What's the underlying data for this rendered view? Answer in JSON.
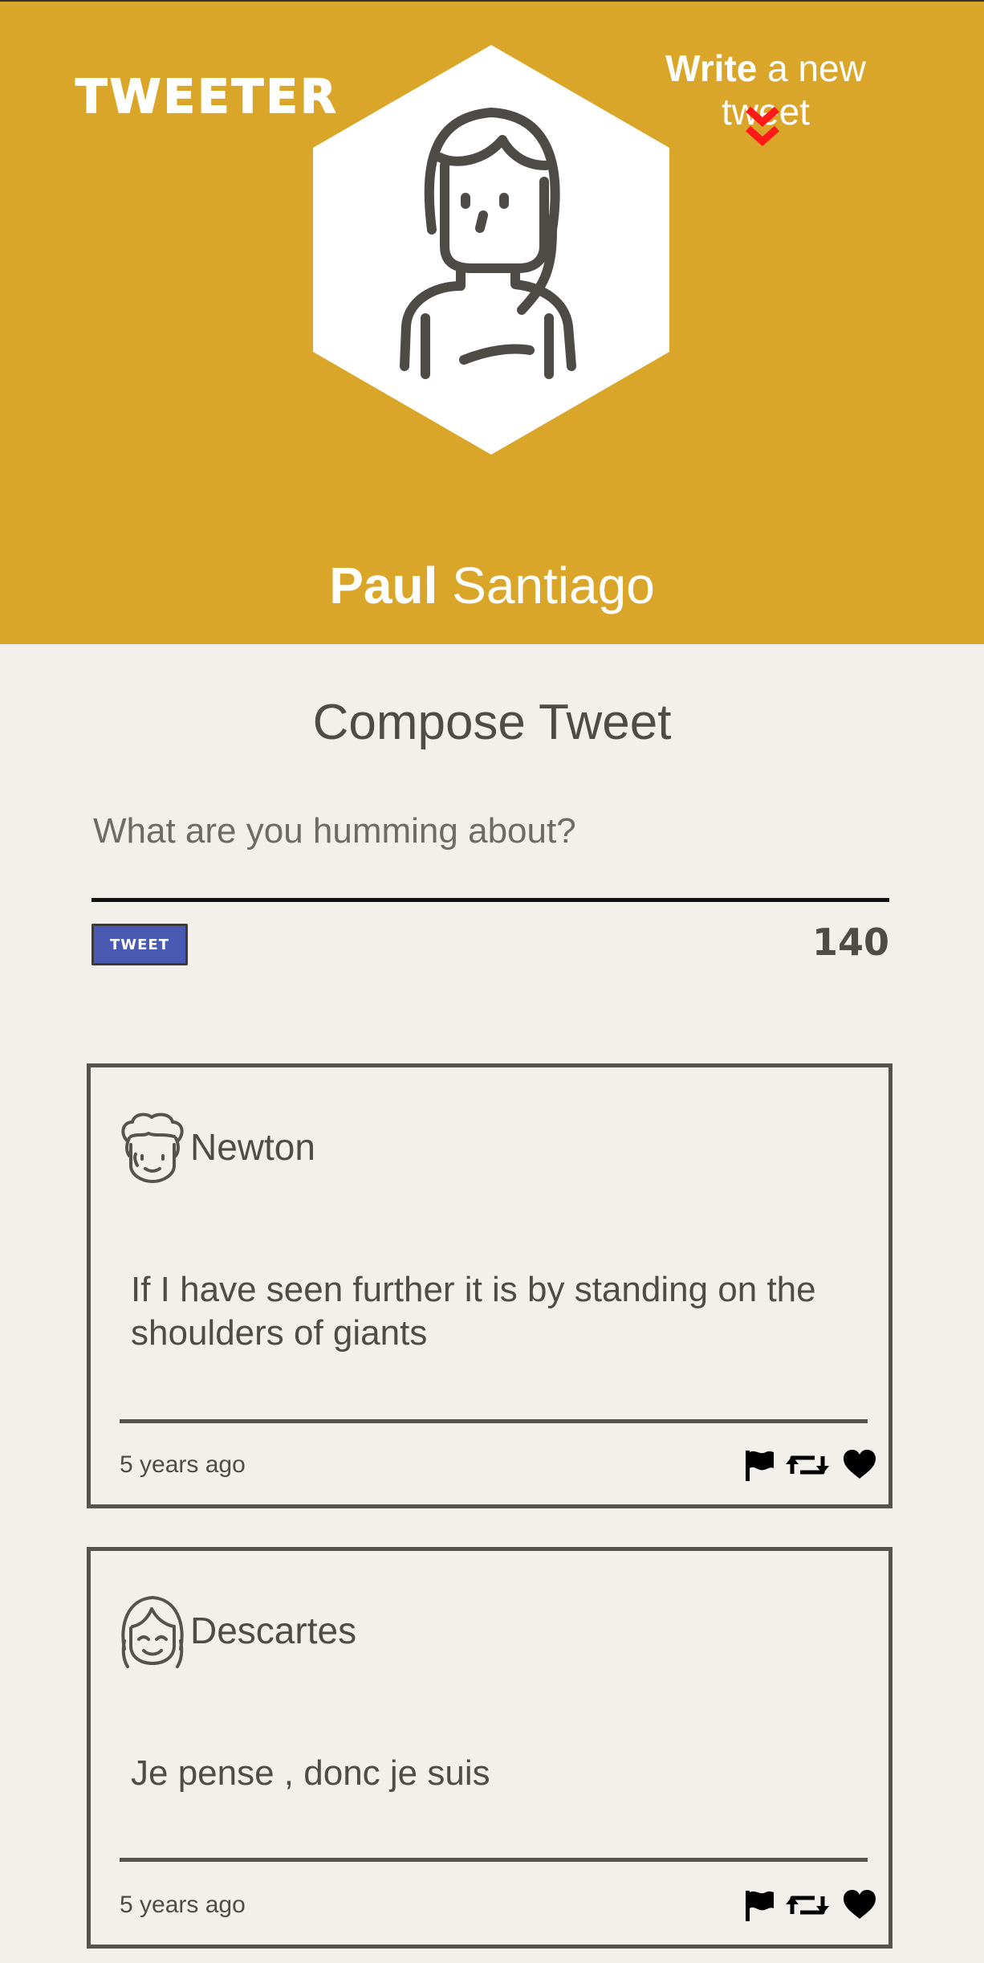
{
  "header": {
    "brand": "TWEETER",
    "write_bold": "Write",
    "write_rest": " a new tweet",
    "user_first": "Paul",
    "user_last": "Santiago"
  },
  "compose": {
    "title": "Compose Tweet",
    "placeholder": "What are you humming about?",
    "button_label": "TWEET",
    "counter": "140"
  },
  "tweets": [
    {
      "handle": "Newton",
      "text": "If I have seen further it is by standing on the shoulders of giants",
      "time": "5 years ago"
    },
    {
      "handle": "Descartes",
      "text": "Je pense , donc je suis",
      "time": "5 years ago"
    }
  ],
  "colors": {
    "header_bg": "#d9a62a",
    "page_bg": "#f3f0ec",
    "button_bg": "#4a5ab3",
    "chevron": "#ff1a1a",
    "text": "#4f4c48"
  },
  "icons": [
    "chevron-down-icon",
    "user-avatar-icon",
    "flag-icon",
    "retweet-icon",
    "heart-icon"
  ]
}
